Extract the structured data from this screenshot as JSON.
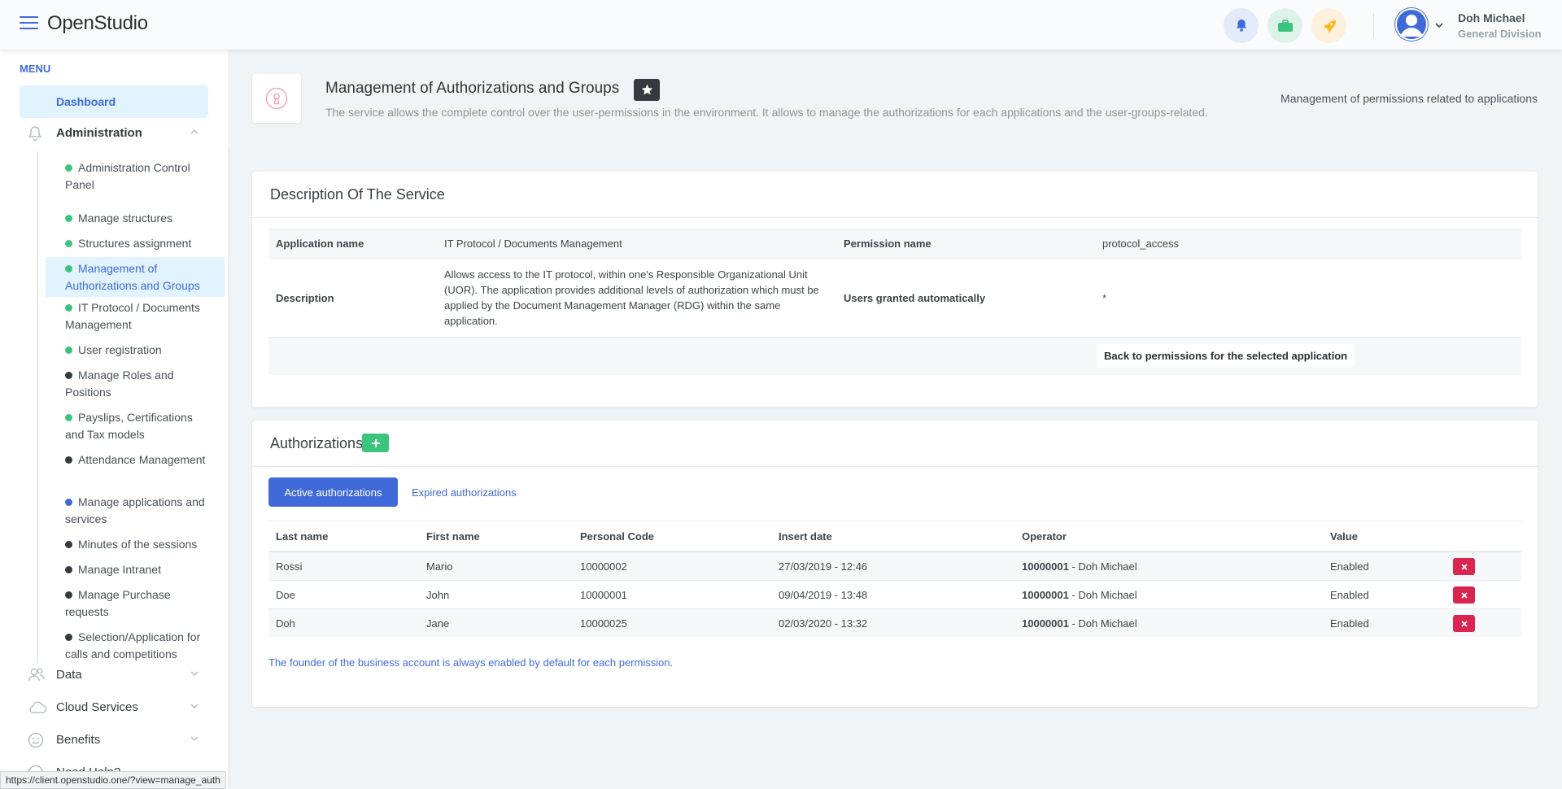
{
  "header": {
    "brand": "OpenStudio",
    "user_name": "Doh Michael",
    "user_division": "General Division"
  },
  "sidebar": {
    "menu_heading": "MENU",
    "dashboard": "Dashboard",
    "categories": {
      "administration": "Administration",
      "data": "Data",
      "cloud": "Cloud Services",
      "benefits": "Benefits",
      "help": "Need Help?"
    },
    "subitems": [
      {
        "label": "Administration Control Panel",
        "status_color": "#3ac47d"
      },
      {
        "label": "Manage structures",
        "status_color": "#3ac47d"
      },
      {
        "label": "Structures assignment",
        "status_color": "#3ac47d"
      },
      {
        "label": "Management of Authorizations and Groups",
        "status_color": "#3ac47d"
      },
      {
        "label": "IT Protocol / Documents Management",
        "status_color": "#3ac47d"
      },
      {
        "label": "User registration",
        "status_color": "#3ac47d"
      },
      {
        "label": "Manage Roles and Positions",
        "status_color": "#343a40"
      },
      {
        "label": "Payslips, Certifications and Tax models",
        "status_color": "#3ac47d"
      },
      {
        "label": "Attendance Management",
        "status_color": "#343a40"
      },
      {
        "label": "Manage applications and services",
        "status_color": "#3f6ad8"
      },
      {
        "label": "Minutes of the sessions",
        "status_color": "#343a40"
      },
      {
        "label": "Manage Intranet",
        "status_color": "#343a40"
      },
      {
        "label": "Manage Purchase requests",
        "status_color": "#343a40"
      },
      {
        "label": "Selection/Application for calls and competitions",
        "status_color": "#343a40"
      }
    ]
  },
  "status_url": "https://client.openstudio.one/?view=manage_auth",
  "page": {
    "title": "Management of Authorizations and Groups",
    "subtitle": "The service allows the complete control over the user-permissions in the environment. It allows to manage the authorizations for each applications and the user-groups-related.",
    "right_text": "Management of permissions related to applications"
  },
  "service": {
    "heading": "Description Of The Service",
    "app_name_label": "Application name",
    "app_name": "IT Protocol / Documents Management",
    "perm_name_label": "Permission name",
    "perm_name": "protocol_access",
    "description_label": "Description",
    "description": "Allows access to the IT protocol, within one's Responsible Organizational Unit (UOR). The application provides additional levels of authorization which must be applied by the Document Management Manager (RDG) within the same application.",
    "auto_label": "Users granted automatically",
    "auto_value": "*",
    "back_link": "Back to permissions for the selected application"
  },
  "authorizations": {
    "heading": "Authorizations",
    "tab_active": "Active authorizations",
    "tab_expired": "Expired authorizations",
    "columns": {
      "last_name": "Last name",
      "first_name": "First name",
      "code": "Personal Code",
      "date": "Insert date",
      "operator": "Operator",
      "value": "Value"
    },
    "rows": [
      {
        "last_name": "Rossi",
        "first_name": "Mario",
        "code": "10000002",
        "date": "27/03/2019 - 12:46",
        "op_code": "10000001",
        "op_name": " - Doh Michael",
        "value": "Enabled"
      },
      {
        "last_name": "Doe",
        "first_name": "John",
        "code": "10000001",
        "date": "09/04/2019 - 13:48",
        "op_code": "10000001",
        "op_name": " - Doh Michael",
        "value": "Enabled"
      },
      {
        "last_name": "Doh",
        "first_name": "Jane",
        "code": "10000025",
        "date": "02/03/2020 - 13:32",
        "op_code": "10000001",
        "op_name": " - Doh Michael",
        "value": "Enabled"
      }
    ],
    "note": "The founder of the business account is always enabled by default for each permission."
  }
}
